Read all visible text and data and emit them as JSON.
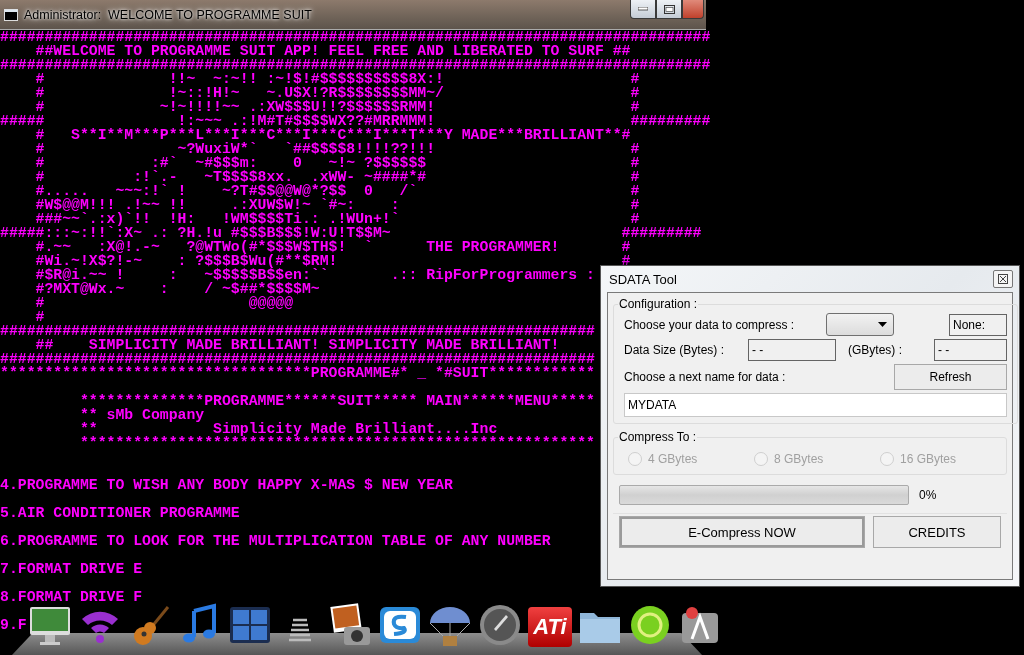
{
  "console_window": {
    "title": "Administrator:  WELCOME TO PROGRAMME SUIT",
    "banner_lines": [
      "################################################################################",
      "    ##WELCOME TO PROGRAMME SUIT APP! FEEL FREE AND LIBERATED TO SURF ##",
      "################################################################################",
      "    #              !!~  ~:~!! :~!$!#$$$$$$$$$$8X:!                     #",
      "    #              !~::!H!~   ~.U$X!?R$$$$$$$$MM~/                     #",
      "    #             ~!~!!!!~~ .:XW$$$U!!?$$$$$$RMM!                      #",
      "#####               !:~~~ .:!M#T#$$$$WX??#MRRMMM!                      #########",
      "    #   S**I**M***P***L***I***C***I***C***I***T***Y MADE***BRILLIANT**#",
      "    #               ~?WuxiW*`   `##$$$$8!!!!??!!!                      #",
      "    #            :#`  ~#$$$m:    0   ~!~ ?$$$$$$                       #",
      "    #          :!`.-   ~T$$$$8xx.  .xWW- ~####*#                       #",
      "    #.....   ~~~:!` !    ~?T#$$@@W@*?$$  0   /`                        #",
      "    #W$@@M!!! .!~~ !!     .:XUW$W!~ `#~:    :                          #",
      "    ###~~`.:x)`!!  !H:   !WM$$$$Ti.: .!WUn+!`                          #",
      "#####:::~:!!`:X~ .: ?H.!u #$$$B$$$!W:U!T$$M~                          #########",
      "    #.~~   :X@!.-~   ?@WTWo(#*$$$W$TH$!  `      THE PROGRAMMER!       #",
      "    #Wi.~!X$?!-~    : ?$$$B$Wu(#**$RM!                                #",
      "    #$R@i.~~ !     :   ~$$$$$B$$en:``       .:: RipForProgrammers :",
      "    #?MXT@Wx.~    :    / ~$##*$$$$M~",
      "    #                       @@@@@",
      "    #",
      "###################################################################",
      "    ##    SIMPLICITY MADE BRILLIANT! SIMPLICITY MADE BRILLIANT!",
      "###################################################################",
      "***********************************PROGRAMME#* _ *#SUIT************"
    ],
    "menu_header_lines": [
      "         **************PROGRAMME******SUIT***** MAIN******MENU*****",
      "         ** sMb Company",
      "         **             Simplicity Made Brilliant....Inc",
      "         **********************************************************"
    ],
    "menu_items": [
      "4.PROGRAMME TO WISH ANY BODY HAPPY X-MAS $ NEW YEAR",
      "5.AIR CONDITIONER PROGRAMME",
      "6.PROGRAMME TO LOOK FOR THE MULTIPLICATION TABLE OF ANY NUMBER",
      "7.FORMAT DRIVE E",
      "8.FORMAT DRIVE F",
      "9.F"
    ]
  },
  "dialog": {
    "title": "SDATA Tool",
    "configuration": {
      "legend": "Configuration :",
      "data_label": "Choose your data to compress :",
      "status": "None:",
      "size_bytes_label": "Data Size (Bytes) :",
      "size_bytes_value": "- -",
      "size_gbytes_label": "(GBytes) :",
      "size_gbytes_value": "- -",
      "name_label": "Choose a next name for data :",
      "refresh_button": "Refresh",
      "name_value": "MYDATA"
    },
    "compress_to": {
      "legend": "Compress To :",
      "options": [
        {
          "label": "4 GBytes",
          "selected": false,
          "disabled": true
        },
        {
          "label": "8 GBytes",
          "selected": false,
          "disabled": true
        },
        {
          "label": "16 GBytes",
          "selected": false,
          "disabled": true
        }
      ]
    },
    "progress": {
      "level": 0,
      "reading": "0%"
    },
    "buttons": [
      "E-Compress NOW",
      "CREDITS"
    ]
  },
  "dock": {
    "logo_text": "ATi"
  }
}
